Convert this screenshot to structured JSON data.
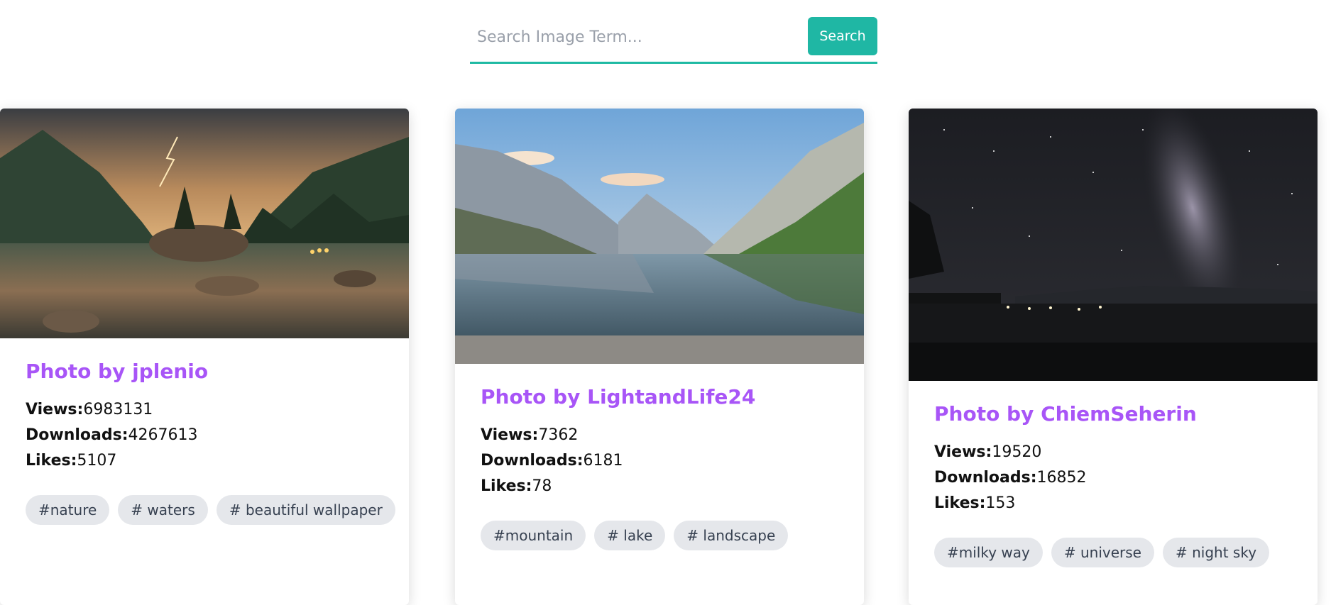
{
  "search": {
    "placeholder": "Search Image Term...",
    "button_label": "Search"
  },
  "cards": [
    {
      "title": "Photo by jplenio",
      "views_label": "Views:",
      "views": "6983131",
      "downloads_label": "Downloads:",
      "downloads": "4267613",
      "likes_label": "Likes:",
      "likes": "5107",
      "tags": [
        "#nature",
        "# waters",
        "# beautiful wallpaper"
      ]
    },
    {
      "title": "Photo by LightandLife24",
      "views_label": "Views:",
      "views": "7362",
      "downloads_label": "Downloads:",
      "downloads": "6181",
      "likes_label": "Likes:",
      "likes": "78",
      "tags": [
        "#mountain",
        "# lake",
        "# landscape"
      ]
    },
    {
      "title": "Photo by ChiemSeherin",
      "views_label": "Views:",
      "views": "19520",
      "downloads_label": "Downloads:",
      "downloads": "16852",
      "likes_label": "Likes:",
      "likes": "153",
      "tags": [
        "#milky way",
        "# universe",
        "# night sky"
      ]
    }
  ],
  "colors": {
    "accent": "#1fb7a4",
    "title": "#a855f7",
    "tag_bg": "#e5e7eb"
  }
}
